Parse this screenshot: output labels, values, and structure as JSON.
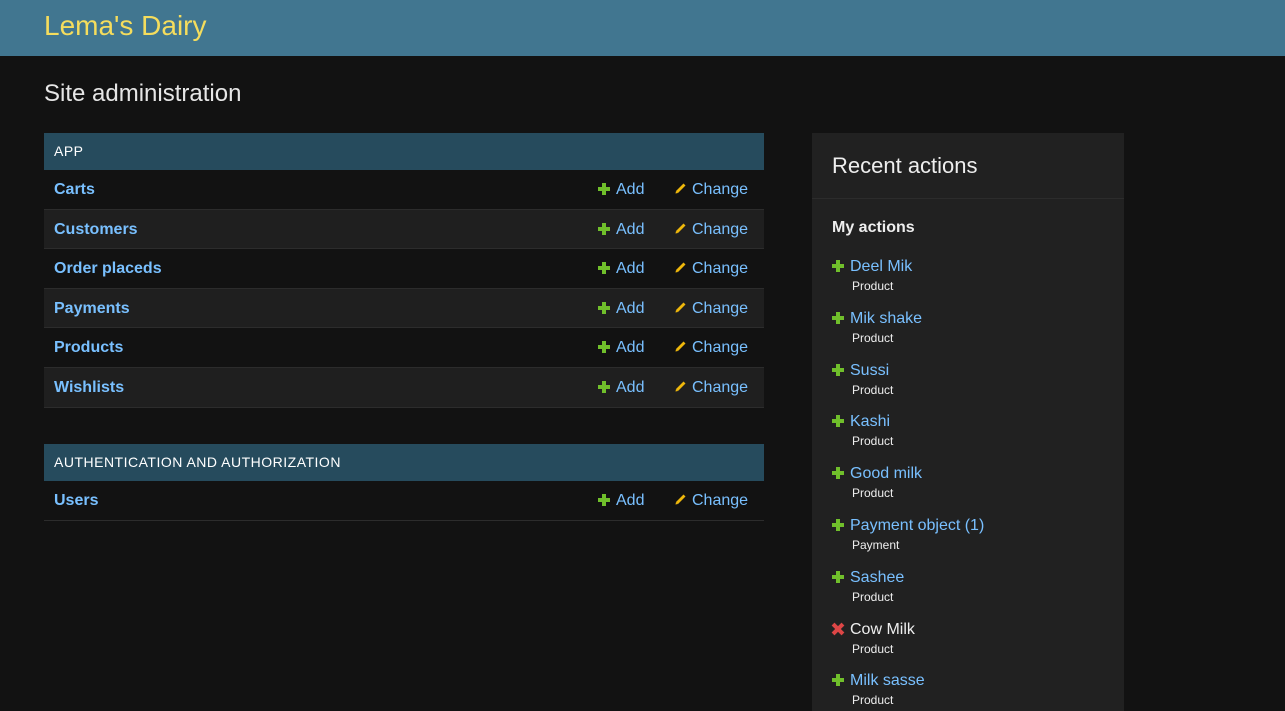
{
  "header": {
    "site_name": "Lema's Dairy"
  },
  "page": {
    "title": "Site administration"
  },
  "modules": [
    {
      "caption": "APP",
      "models": [
        {
          "name": "Carts",
          "add": "Add",
          "change": "Change"
        },
        {
          "name": "Customers",
          "add": "Add",
          "change": "Change"
        },
        {
          "name": "Order placeds",
          "add": "Add",
          "change": "Change"
        },
        {
          "name": "Payments",
          "add": "Add",
          "change": "Change"
        },
        {
          "name": "Products",
          "add": "Add",
          "change": "Change"
        },
        {
          "name": "Wishlists",
          "add": "Add",
          "change": "Change"
        }
      ]
    },
    {
      "caption": "AUTHENTICATION AND AUTHORIZATION",
      "models": [
        {
          "name": "Users",
          "add": "Add",
          "change": "Change"
        }
      ]
    }
  ],
  "recent_actions": {
    "title": "Recent actions",
    "subtitle": "My actions",
    "items": [
      {
        "label": "Deel Mik",
        "type": "Product",
        "action": "addition",
        "icon": "plus-icon"
      },
      {
        "label": "Mik shake",
        "type": "Product",
        "action": "addition",
        "icon": "plus-icon"
      },
      {
        "label": "Sussi",
        "type": "Product",
        "action": "addition",
        "icon": "plus-icon"
      },
      {
        "label": "Kashi",
        "type": "Product",
        "action": "addition",
        "icon": "plus-icon"
      },
      {
        "label": "Good milk",
        "type": "Product",
        "action": "addition",
        "icon": "plus-icon"
      },
      {
        "label": "Payment object (1)",
        "type": "Payment",
        "action": "addition",
        "icon": "plus-icon"
      },
      {
        "label": "Sashee",
        "type": "Product",
        "action": "addition",
        "icon": "plus-icon"
      },
      {
        "label": "Cow Milk",
        "type": "Product",
        "action": "deletion",
        "icon": "x-icon"
      },
      {
        "label": "Milk sasse",
        "type": "Product",
        "action": "addition",
        "icon": "plus-icon"
      }
    ]
  },
  "colors": {
    "header_bg": "#417690",
    "branding": "#f5dd5d",
    "caption_bg": "#264b5d",
    "link": "#79c0ff",
    "add_green": "#70bf2b",
    "change_yellow": "#efb80b",
    "delete_red": "#dd4646"
  }
}
